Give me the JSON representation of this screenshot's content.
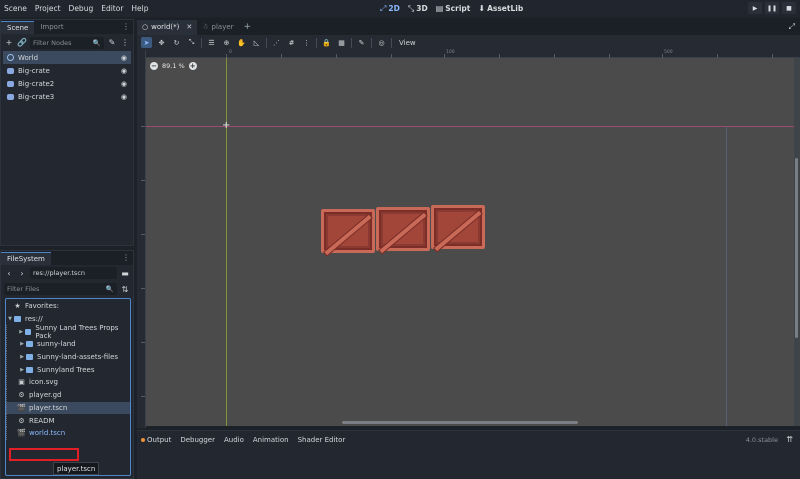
{
  "menubar": {
    "items": [
      "Scene",
      "Project",
      "Debug",
      "Editor",
      "Help"
    ],
    "modes": [
      {
        "label": "2D",
        "icon": "2d-icon",
        "active": true
      },
      {
        "label": "3D",
        "icon": "3d-icon",
        "active": false
      },
      {
        "label": "Script",
        "icon": "script-icon",
        "active": false
      },
      {
        "label": "AssetLib",
        "icon": "assetlib-icon",
        "active": false
      }
    ]
  },
  "scene_panel": {
    "tabs": [
      "Scene",
      "Import"
    ],
    "filter_placeholder": "Filter Nodes",
    "nodes": [
      {
        "label": "World",
        "type": "root"
      },
      {
        "label": "Big-crate",
        "type": "sprite"
      },
      {
        "label": "Big-crate2",
        "type": "sprite"
      },
      {
        "label": "Big-crate3",
        "type": "sprite"
      }
    ]
  },
  "filesystem": {
    "tab": "FileSystem",
    "path": "res://player.tscn",
    "filter_placeholder": "Filter Files",
    "rows": [
      {
        "label": "Favorites:",
        "kind": "favorites"
      },
      {
        "label": "res://",
        "kind": "root"
      },
      {
        "label": "Sunny Land Trees Props Pack",
        "kind": "folder"
      },
      {
        "label": "sunny-land",
        "kind": "folder"
      },
      {
        "label": "Sunny-land-assets-files",
        "kind": "folder"
      },
      {
        "label": "Sunnyland Trees",
        "kind": "folder"
      },
      {
        "label": "icon.svg",
        "kind": "svg"
      },
      {
        "label": "player.gd",
        "kind": "script"
      },
      {
        "label": "player.tscn",
        "kind": "scene"
      },
      {
        "label": "READM",
        "kind": "file"
      },
      {
        "label": "world.tscn",
        "kind": "scene"
      }
    ],
    "tooltip": "player.tscn"
  },
  "editor": {
    "tabs": [
      {
        "label": "world(*)",
        "active": true
      },
      {
        "label": "player",
        "active": false
      }
    ],
    "view_label": "View",
    "zoom": "89.1 %",
    "ruler_labels": [
      "0",
      "100",
      "500"
    ]
  },
  "bottom_panel": {
    "tabs": [
      "Output",
      "Debugger",
      "Audio",
      "Animation",
      "Shader Editor"
    ],
    "version": "4.0.stable"
  }
}
